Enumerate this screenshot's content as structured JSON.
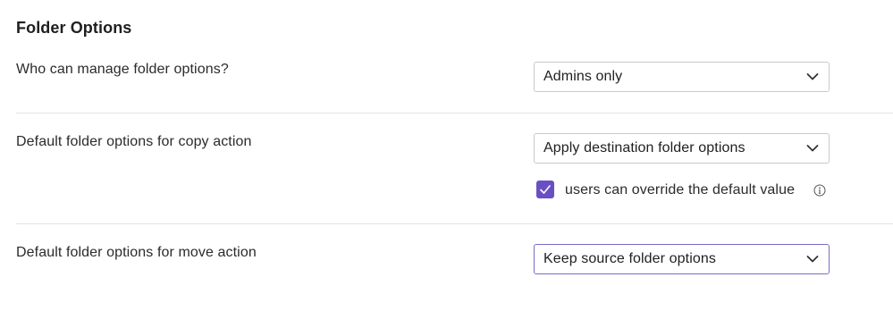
{
  "section": {
    "title": "Folder Options"
  },
  "settings": [
    {
      "label": "Who can manage folder options?",
      "selected": "Admins only"
    },
    {
      "label": "Default folder options for copy action",
      "selected": "Apply destination folder options",
      "override_checkbox": {
        "label": "users can override the default value",
        "checked": true,
        "icon": "info-icon"
      }
    },
    {
      "label": "Default folder options for move action",
      "selected": "Keep source folder options"
    }
  ],
  "colors": {
    "accent": "#6a4fc4",
    "divider": "#e3e3e3",
    "focus_border": "#7b6cc9"
  },
  "icons": {
    "dropdown": "chevron-down-icon",
    "check": "checkmark-icon",
    "info": "info-icon"
  }
}
